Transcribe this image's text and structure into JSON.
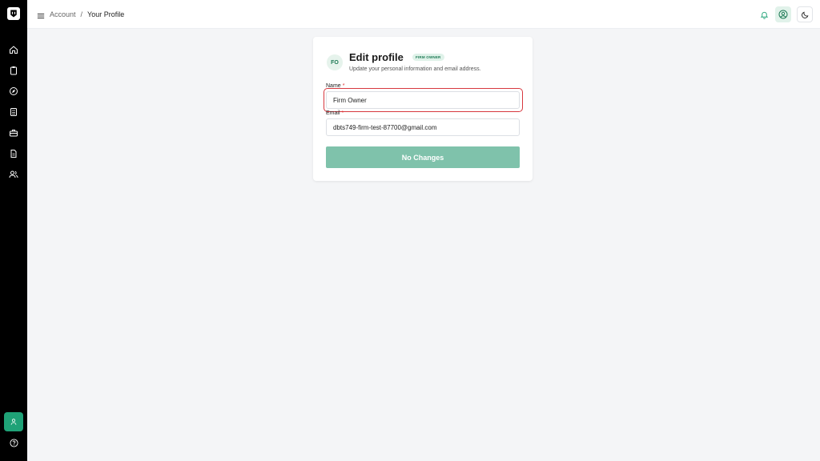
{
  "header": {
    "breadcrumb": [
      "Account",
      "Your Profile"
    ],
    "separator": "/"
  },
  "sidebar": {
    "items": [
      {
        "name": "home-icon"
      },
      {
        "name": "clipboard-icon"
      },
      {
        "name": "compass-icon"
      },
      {
        "name": "calculator-icon"
      },
      {
        "name": "briefcase-icon"
      },
      {
        "name": "document-icon"
      },
      {
        "name": "users-icon"
      }
    ],
    "bottom": [
      {
        "name": "user-icon"
      },
      {
        "name": "help-icon"
      }
    ]
  },
  "card": {
    "avatar_initials": "FO",
    "title": "Edit profile",
    "role_badge": "FIRM OWNER",
    "subtitle": "Update your personal information and email address.",
    "name_label": "Name",
    "name_value": "Firm Owner",
    "email_label": "Email",
    "email_value": "dbts749-firm-test-87700@gmail.com",
    "required_mark": "*",
    "submit_label": "No Changes"
  },
  "colors": {
    "accent": "#1fa277",
    "submit_disabled": "#7fc2ab",
    "highlight": "#d7383f"
  }
}
